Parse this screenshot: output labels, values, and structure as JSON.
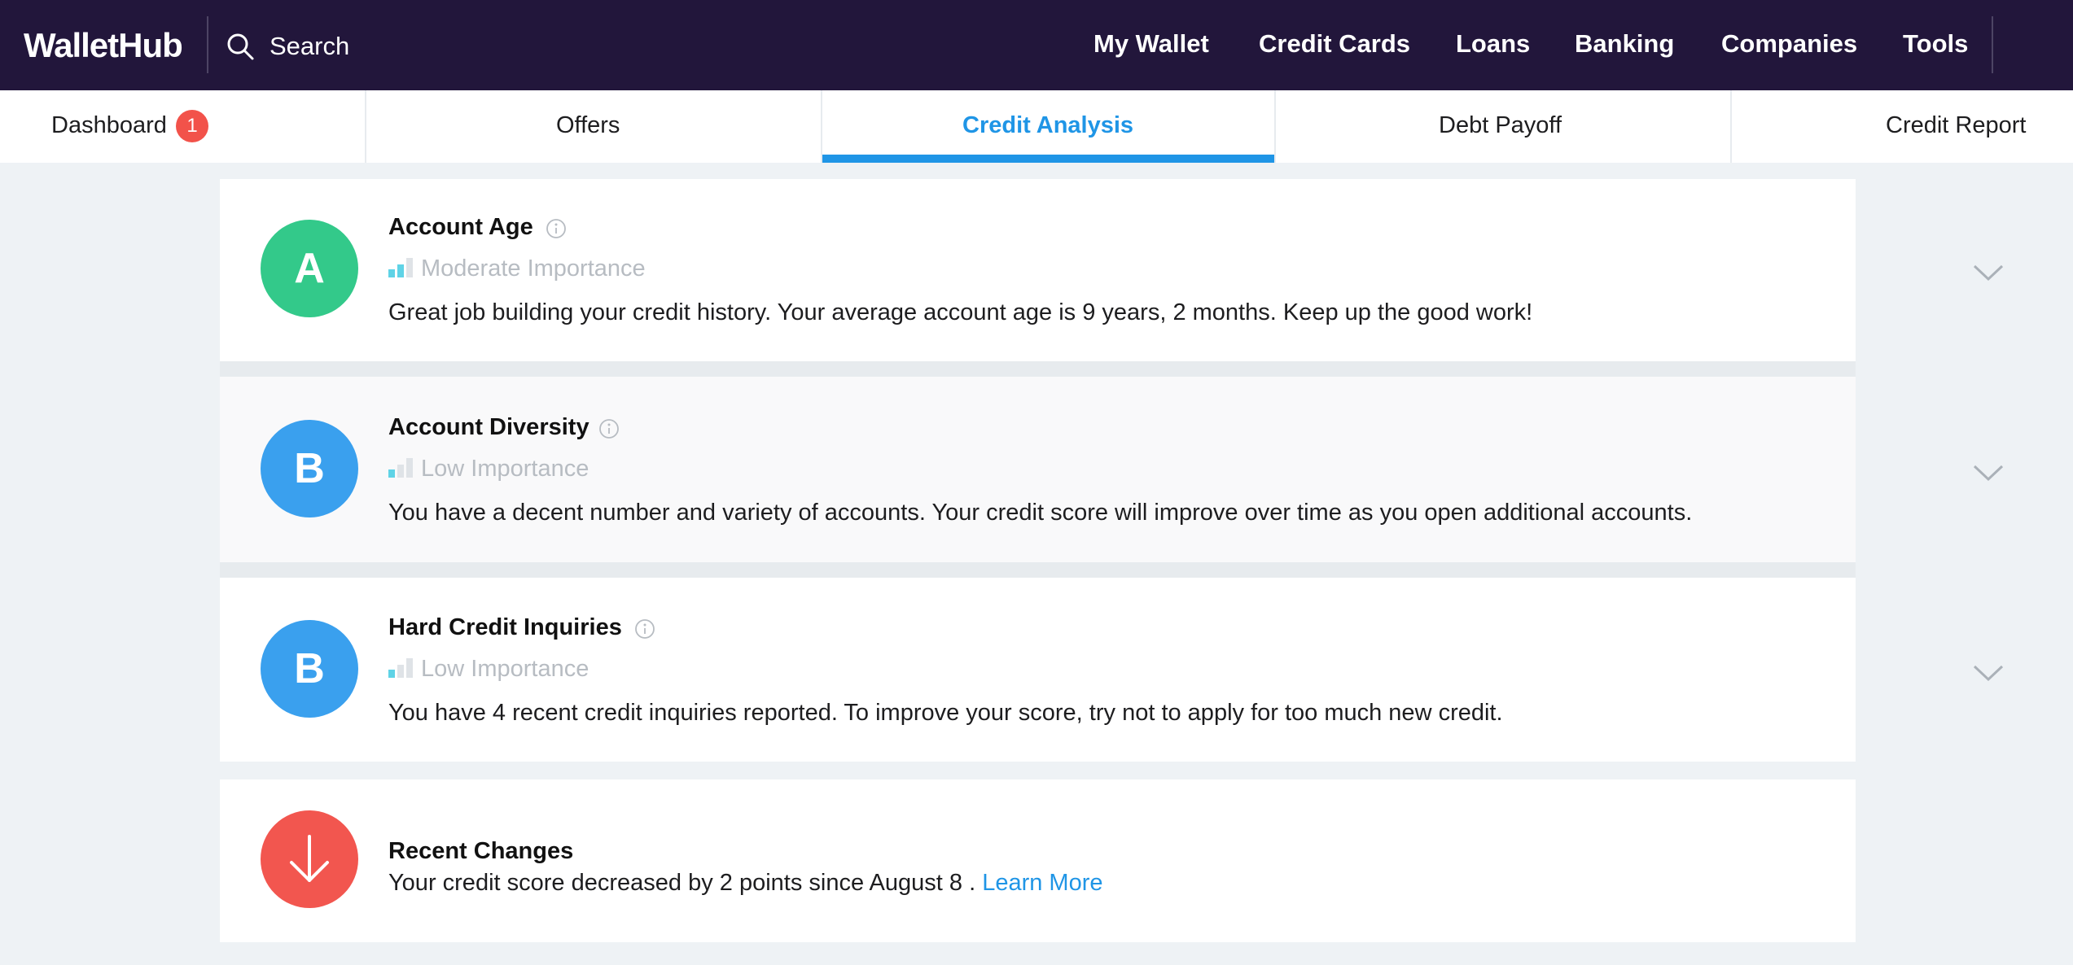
{
  "header": {
    "logo": "WalletHub",
    "search_label": "Search",
    "nav": [
      "My Wallet",
      "Credit Cards",
      "Loans",
      "Banking",
      "Companies",
      "Tools"
    ]
  },
  "tabs": [
    {
      "label": "Dashboard",
      "badge": "1"
    },
    {
      "label": "Offers"
    },
    {
      "label": "Credit Analysis",
      "active": true
    },
    {
      "label": "Debt Payoff"
    },
    {
      "label": "Credit Report"
    }
  ],
  "factors": [
    {
      "grade": "A",
      "grade_color": "#33c98a",
      "title": "Account Age",
      "importance": "Moderate Importance",
      "importance_level": 2,
      "description": "Great job building your credit history. Your average account age is 9 years, 2 months. Keep up the good work!"
    },
    {
      "grade": "B",
      "grade_color": "#3aa0ee",
      "title": "Account Diversity",
      "importance": "Low Importance",
      "importance_level": 1,
      "description": "You have a decent number and variety of accounts. Your credit score will improve over time as you open additional accounts."
    },
    {
      "grade": "B",
      "grade_color": "#3aa0ee",
      "title": "Hard Credit Inquiries",
      "importance": "Low Importance",
      "importance_level": 1,
      "description": "You have 4 recent credit inquiries reported. To improve your score, try not to apply for too much new credit."
    }
  ],
  "recent_changes": {
    "title": "Recent Changes",
    "description": "Your credit score decreased by 2 points since August 8 .",
    "link": "Learn More",
    "icon_color": "#f2564f"
  },
  "colors": {
    "nav_bg": "#22163b",
    "accent": "#1f95e6",
    "badge": "#f2524a",
    "importance_bar_on": "#5fd3e6",
    "importance_bar_off": "#dfe3e7"
  }
}
